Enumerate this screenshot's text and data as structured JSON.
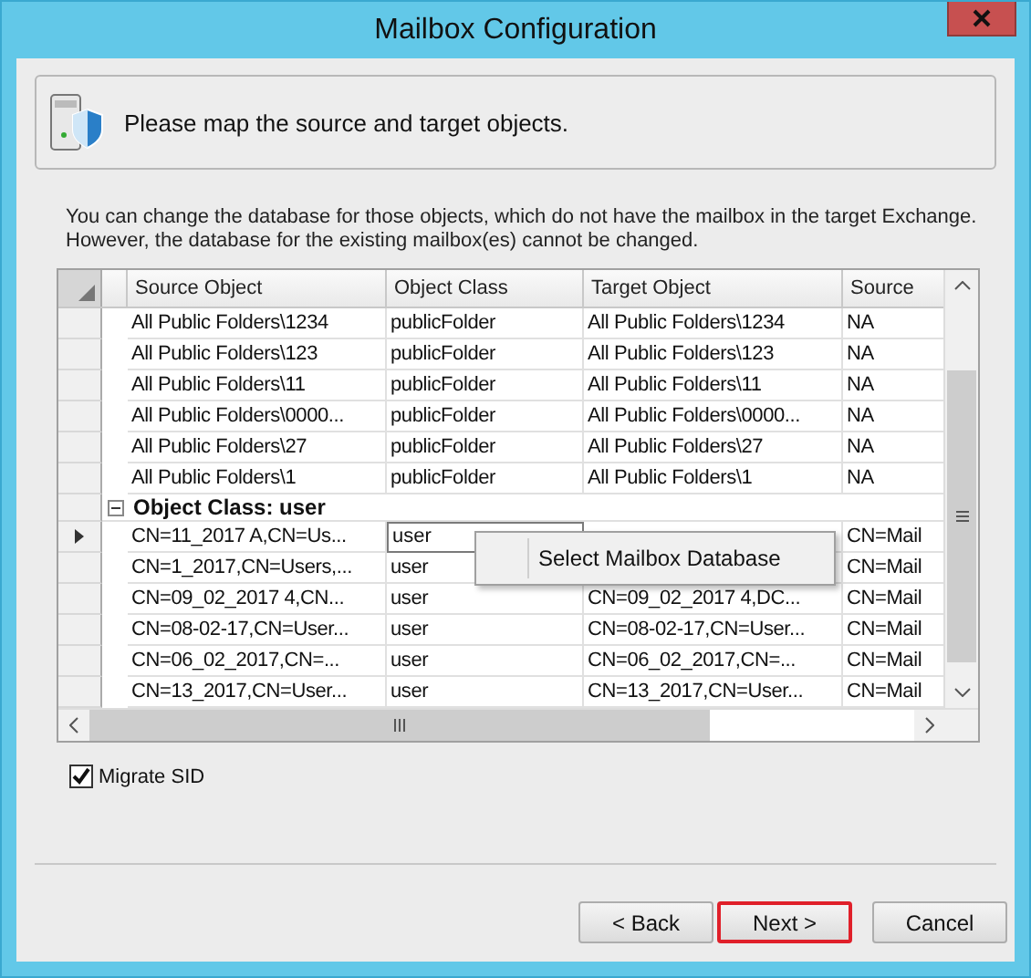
{
  "window": {
    "title": "Mailbox Configuration"
  },
  "header": {
    "text": "Please map the source and target objects."
  },
  "description": [
    "You can change the database for those objects, which do not have the mailbox in the target Exchange.",
    "However, the database for the existing mailbox(es) cannot be changed."
  ],
  "table": {
    "columns": [
      "Source Object",
      "Object Class",
      "Target Object",
      "Source"
    ],
    "rows": [
      {
        "kind": "data",
        "current": false,
        "editing": false,
        "cells": [
          "All Public Folders\\1234",
          "publicFolder",
          "All Public Folders\\1234",
          "NA"
        ]
      },
      {
        "kind": "data",
        "current": false,
        "editing": false,
        "cells": [
          "All Public Folders\\123",
          "publicFolder",
          "All Public Folders\\123",
          "NA"
        ]
      },
      {
        "kind": "data",
        "current": false,
        "editing": false,
        "cells": [
          "All Public Folders\\11",
          "publicFolder",
          "All Public Folders\\11",
          "NA"
        ]
      },
      {
        "kind": "data",
        "current": false,
        "editing": false,
        "cells": [
          "All Public Folders\\0000...",
          "publicFolder",
          "All Public Folders\\0000...",
          "NA"
        ]
      },
      {
        "kind": "data",
        "current": false,
        "editing": false,
        "cells": [
          "All Public Folders\\27",
          "publicFolder",
          "All Public Folders\\27",
          "NA"
        ]
      },
      {
        "kind": "data",
        "current": false,
        "editing": false,
        "cells": [
          "All Public Folders\\1",
          "publicFolder",
          "All Public Folders\\1",
          "NA"
        ]
      },
      {
        "kind": "group",
        "expanded": true,
        "label": "Object Class: user"
      },
      {
        "kind": "data",
        "current": true,
        "editing": true,
        "cells": [
          "CN=11_2017 A,CN=Us...",
          "user",
          null,
          "CN=Mail"
        ]
      },
      {
        "kind": "data",
        "current": false,
        "editing": false,
        "cells": [
          "CN=1_2017,CN=Users,...",
          "user",
          null,
          "CN=Mail"
        ]
      },
      {
        "kind": "data",
        "current": false,
        "editing": false,
        "cells": [
          "CN=09_02_2017 4,CN...",
          "user",
          "CN=09_02_2017 4,DC...",
          "CN=Mail"
        ]
      },
      {
        "kind": "data",
        "current": false,
        "editing": false,
        "cells": [
          "CN=08-02-17,CN=User...",
          "user",
          "CN=08-02-17,CN=User...",
          "CN=Mail"
        ]
      },
      {
        "kind": "data",
        "current": false,
        "editing": false,
        "cells": [
          "CN=06_02_2017,CN=...",
          "user",
          "CN=06_02_2017,CN=...",
          "CN=Mail"
        ]
      },
      {
        "kind": "data",
        "current": false,
        "editing": false,
        "cells": [
          "CN=13_2017,CN=User...",
          "user",
          "CN=13_2017,CN=User...",
          "CN=Mail"
        ]
      }
    ]
  },
  "context_menu": {
    "items": [
      "Select Mailbox Database"
    ]
  },
  "migrate_sid": {
    "label": "Migrate SID",
    "checked": true
  },
  "buttons": [
    {
      "label": "< Back",
      "highlighted": false
    },
    {
      "label": "Next >",
      "highlighted": true
    },
    {
      "label": "Cancel",
      "highlighted": false
    }
  ]
}
